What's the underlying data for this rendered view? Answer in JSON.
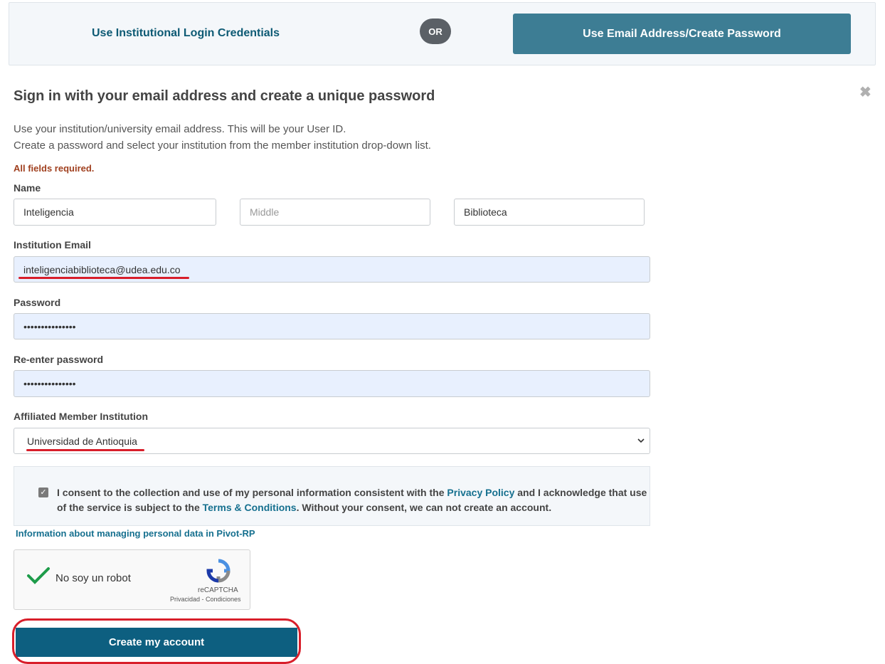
{
  "tabs": {
    "institutional": "Use Institutional Login Credentials",
    "or": "OR",
    "email": "Use Email Address/Create Password"
  },
  "close_icon": "close-icon",
  "heading": "Sign in with your email address and create a unique password",
  "intro": {
    "line1": "Use your institution/university email address. This will be your User ID.",
    "line2": "Create a password and select your institution from the member institution drop-down list."
  },
  "required_note": "All fields required.",
  "name": {
    "label": "Name",
    "first": "Inteligencia",
    "middle_placeholder": "Middle",
    "last": "Biblioteca"
  },
  "email": {
    "label": "Institution Email",
    "value": "inteligenciabiblioteca@udea.edu.co"
  },
  "password": {
    "label": "Password",
    "value": "•••••••••••••••"
  },
  "reenter": {
    "label": "Re-enter password",
    "value": "•••••••••••••••"
  },
  "institution": {
    "label": "Affiliated Member Institution",
    "selected": "Universidad de Antioquia"
  },
  "consent": {
    "checked": true,
    "text1": "I consent to the collection and use of my personal information consistent with the ",
    "privacy_link": "Privacy Policy",
    "text2": " and I acknowledge that use of the service is subject to the ",
    "terms_link": "Terms & Conditions",
    "text3": ". Without your consent, we can not create an account."
  },
  "data_link": "Information about managing personal data in Pivot-RP",
  "captcha": {
    "label": "No soy un robot",
    "brand": "reCAPTCHA",
    "footer": "Privacidad - Condiciones"
  },
  "submit_label": "Create my account",
  "colors": {
    "accent": "#3d7d94",
    "primary_button": "#0d5f80",
    "annotation": "#d81e2a"
  }
}
